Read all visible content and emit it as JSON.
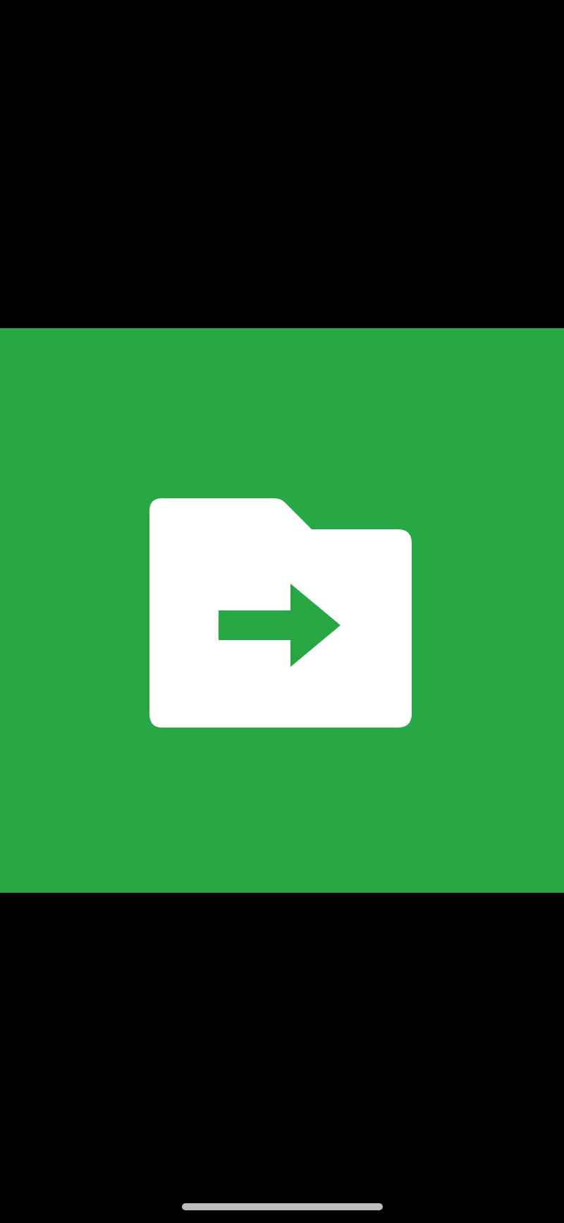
{
  "splash": {
    "background_color": "#28a745",
    "icon": "folder-move-icon",
    "icon_color": "#ffffff",
    "arrow_color": "#28a745"
  },
  "screen": {
    "background_color": "#000000"
  },
  "home_indicator": {
    "color": "#bdbdbd"
  }
}
